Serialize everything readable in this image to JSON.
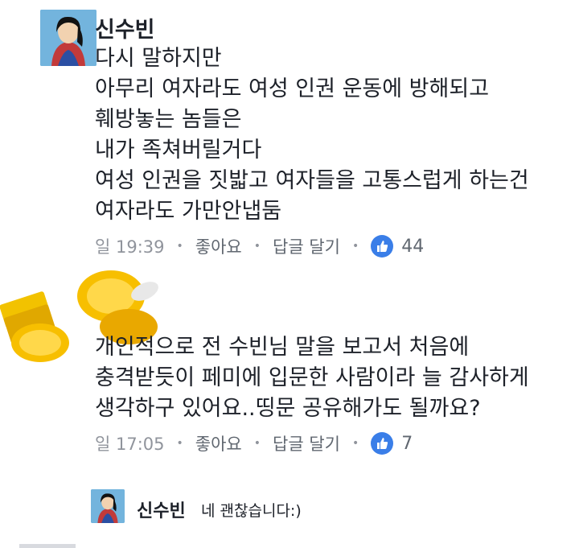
{
  "comment1": {
    "author": "신수빈",
    "lines": [
      "다시 말하지만",
      "아무리 여자라도 여성 인권 운동에 방해되고",
      "훼방놓는 놈들은",
      "내가 족쳐버릴거다",
      "여성 인권을 짓밟고 여자들을 고통스럽게 하는건",
      "여자라도 가만안냅둠"
    ],
    "time": "일 19:39",
    "like_label": "좋아요",
    "reply_label": "답글 달기",
    "like_count": "44"
  },
  "comment2": {
    "lines": [
      "개인적으로 전 수빈님 말을 보고서 처음에",
      "충격받듯이 페미에 입문한 사람이라 늘 감사하게",
      "생각하구 있어요..띵문 공유해가도 될까요?"
    ],
    "time": "일 17:05",
    "like_label": "좋아요",
    "reply_label": "답글 달기",
    "like_count": "7"
  },
  "reply": {
    "author": "신수빈",
    "text": "네 괜찮습니다:)"
  },
  "colors": {
    "meta_gray": "#90949c",
    "like_blue": "#3a7ee8",
    "gold": "#f5b800"
  }
}
